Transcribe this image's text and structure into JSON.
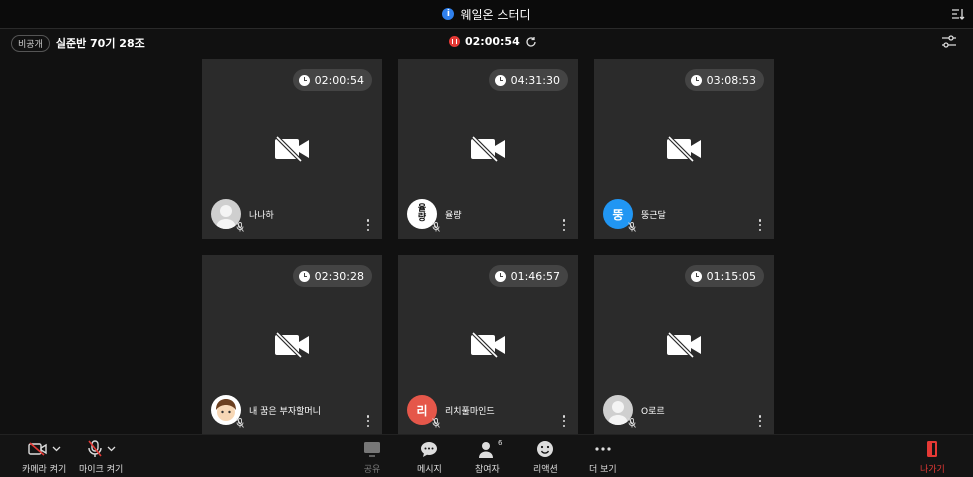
{
  "window": {
    "title": "웨일온 스터디"
  },
  "subbar": {
    "privacy_badge": "비공개",
    "room_name": "실준반 70기 28조",
    "session_timer": "02:00:54"
  },
  "participants": [
    {
      "name": "나나하",
      "timer": "02:00:54",
      "avatar_type": "gray",
      "avatar_text": ""
    },
    {
      "name": "율량",
      "timer": "04:31:30",
      "avatar_type": "white",
      "avatar_text": "율\n량"
    },
    {
      "name": "뚱근달",
      "timer": "03:08:53",
      "avatar_type": "blue",
      "avatar_text": "뚱"
    },
    {
      "name": "내 꿈은 부자할머니",
      "timer": "02:30:28",
      "avatar_type": "kid",
      "avatar_text": ""
    },
    {
      "name": "리치풀마인드",
      "timer": "01:46:57",
      "avatar_type": "red",
      "avatar_text": "리"
    },
    {
      "name": "O로르",
      "timer": "01:15:05",
      "avatar_type": "gray",
      "avatar_text": ""
    }
  ],
  "toolbar": {
    "camera_label": "카메라 켜기",
    "mic_label": "마이크 켜기",
    "share_label": "공유",
    "message_label": "메시지",
    "participants_label": "참여자",
    "participants_count": "6",
    "reaction_label": "리액션",
    "more_label": "더 보기",
    "leave_label": "나가기"
  },
  "colors": {
    "accent_red": "#e53935",
    "info_blue": "#2f80ed",
    "tile_bg": "#2b2b2b"
  }
}
